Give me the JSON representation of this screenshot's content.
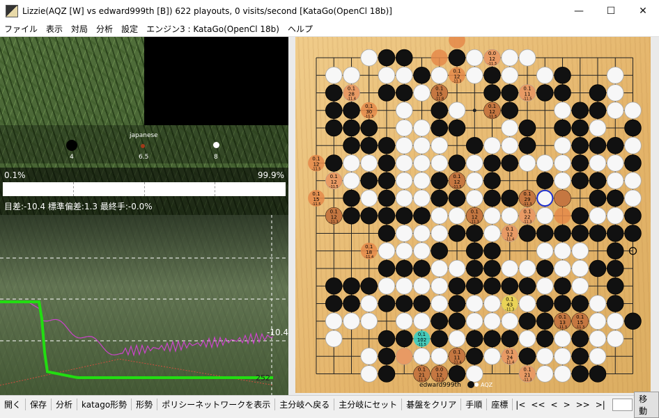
{
  "window": {
    "title": "Lizzie(AQZ [W] vs edward999th [B]) 622 playouts, 0 visits/second [KataGo(OpenCl 18b)]",
    "controls": {
      "minimize": "—",
      "maximize": "☐",
      "close": "✕"
    }
  },
  "menu": [
    "ファイル",
    "表示",
    "対局",
    "分析",
    "設定",
    "エンジン3 : KataGo(OpenCl 18b)",
    "ヘルプ"
  ],
  "info": {
    "rules": "japanese",
    "black_captures": "4",
    "komi": "6.5",
    "white_captures": "8"
  },
  "winrate": {
    "black": "0.1%",
    "white": "99.9%",
    "white_fraction": 0.999,
    "score_line": "目差:-10.4 標準偏差:1.3 最終手:-0.0%"
  },
  "graph": {
    "score_label": "-10.4",
    "move_label": "252",
    "colors": {
      "winrate": "#22dd11",
      "score": "#cc44cc",
      "stdev": "#d05040"
    }
  },
  "board": {
    "size": 19,
    "rows": [
      "...wbb.fbwwww......",
      ".ww.wwbwfwbw.wb..w.",
      ".bw.bbwb..bbwbb.bw.",
      ".bb..w.bw.bb..wbbww",
      ".bbb.wwbb..wb.bbw.b",
      "..bbbwww.bwwb.wbbbw",
      ".bwwbwwwbwbbwwwbwwb",
      ".wwbbwwbbwb..bwbbww",
      "..bwbwwbbwbbbwb.bbw",
      ".bbbbbbwwbwwww.bwwb",
      "....bwwwbbwwbbbbbbb",
      "....wwwb.bb..www.b.",
      "....bbbwwbbwwbwwbb.",
      ".bbbwwwwbbbbbwbw.b.",
      ".bbwbbbwbwwwwbbbwb.",
      ".www.wwbbwwwbbbbwwb",
      ".w..bb.bwbbbwbwbww.",
      "...wbwwwbbwwbwwbw..",
      "...wb.bbbw..wwwbb.."
    ],
    "last_move": "R8",
    "candidates": [
      {
        "pt": [
          8,
          0
        ],
        "winrate": "",
        "visits": "",
        "score": ""
      },
      {
        "pt": [
          7,
          1
        ],
        "winrate": "",
        "visits": "",
        "score": ""
      },
      {
        "pt": [
          10,
          1
        ],
        "winrate": "0.0",
        "visits": "12",
        "score": "-11.3"
      },
      {
        "pt": [
          2,
          3
        ],
        "winrate": "0.1",
        "visits": "28",
        "score": "-11.4"
      },
      {
        "pt": [
          7,
          3
        ],
        "winrate": "0.1",
        "visits": "15",
        "score": "-11.8"
      },
      {
        "pt": [
          8,
          2
        ],
        "winrate": "0.1",
        "visits": "12",
        "score": "-11.3"
      },
      {
        "pt": [
          12,
          3
        ],
        "winrate": "0.1",
        "visits": "11",
        "score": "-11.5"
      },
      {
        "pt": [
          3,
          4
        ],
        "winrate": "0.1",
        "visits": "30",
        "score": "-11.3"
      },
      {
        "pt": [
          10,
          4
        ],
        "winrate": "0.1",
        "visits": "12",
        "score": "-11.3"
      },
      {
        "pt": [
          0,
          7
        ],
        "winrate": "0.1",
        "visits": "12",
        "score": "-11.5"
      },
      {
        "pt": [
          1,
          8
        ],
        "winrate": "0.1",
        "visits": "12",
        "score": "-11.5"
      },
      {
        "pt": [
          8,
          8
        ],
        "winrate": "0.1",
        "visits": "12",
        "score": "-11.5"
      },
      {
        "pt": [
          0,
          9
        ],
        "winrate": "0.1",
        "visits": "15",
        "score": "-11.5"
      },
      {
        "pt": [
          1,
          10
        ],
        "winrate": "0.1",
        "visits": "12",
        "score": "-11.3"
      },
      {
        "pt": [
          9,
          10
        ],
        "winrate": "0.1",
        "visits": "12",
        "score": "-11.3"
      },
      {
        "pt": [
          12,
          9
        ],
        "winrate": "0.1",
        "visits": "29",
        "score": "-11.3"
      },
      {
        "pt": [
          12,
          10
        ],
        "winrate": "0.1",
        "visits": "22",
        "score": "-11.3"
      },
      {
        "pt": [
          14,
          9
        ],
        "winrate": "",
        "visits": "",
        "score": ""
      },
      {
        "pt": [
          14,
          10
        ],
        "winrate": "",
        "visits": "",
        "score": ""
      },
      {
        "pt": [
          11,
          11
        ],
        "winrate": "0.1",
        "visits": "12",
        "score": "-11.4"
      },
      {
        "pt": [
          3,
          12
        ],
        "winrate": "0.1",
        "visits": "18",
        "score": "-11.4"
      },
      {
        "pt": [
          11,
          15
        ],
        "winrate": "0.1",
        "visits": "43",
        "score": "-11.3"
      },
      {
        "pt": [
          14,
          16
        ],
        "winrate": "0.1",
        "visits": "13",
        "score": "-11.3"
      },
      {
        "pt": [
          15,
          16
        ],
        "winrate": "0.1",
        "visits": "15",
        "score": "-11.3"
      },
      {
        "pt": [
          6,
          17
        ],
        "winrate": "0.1",
        "visits": "102",
        "score": "-11.5"
      },
      {
        "pt": [
          5,
          18
        ],
        "winrate": "",
        "visits": "",
        "score": ""
      },
      {
        "pt": [
          8,
          18
        ],
        "winrate": "0.1",
        "visits": "11",
        "score": "-11.4"
      },
      {
        "pt": [
          11,
          18
        ],
        "winrate": "0.1",
        "visits": "24",
        "score": "-11.4"
      },
      {
        "pt": [
          6,
          19
        ],
        "winrate": "0.1",
        "visits": "21",
        "score": "-11.3"
      },
      {
        "pt": [
          7,
          19
        ],
        "winrate": "0.0",
        "visits": "12",
        "score": "-11.2"
      },
      {
        "pt": [
          12,
          19
        ],
        "winrate": "0.1",
        "visits": "21",
        "score": "-11.3"
      }
    ],
    "best_move_pt": [
      6,
      17
    ],
    "second_move_pt": [
      11,
      15
    ],
    "hover_pt": [
      13,
      8
    ],
    "players": {
      "black": "edward999th",
      "white": "AQZ"
    }
  },
  "toolbar": [
    "開く",
    "保存",
    "分析",
    "katago形勢",
    "形勢",
    "ポリシーネットワークを表示",
    "主分岐へ戻る",
    "主分岐にセット",
    "碁盤をクリア",
    "手順",
    "座標",
    "|<",
    "<<",
    "<",
    ">",
    ">>",
    ">|"
  ],
  "toolbar_move_label": "移動",
  "colors": {
    "board": "#e8b872",
    "candidate": "#e58a4a",
    "best": "#2ed0c8",
    "second": "#e8cc3a"
  }
}
